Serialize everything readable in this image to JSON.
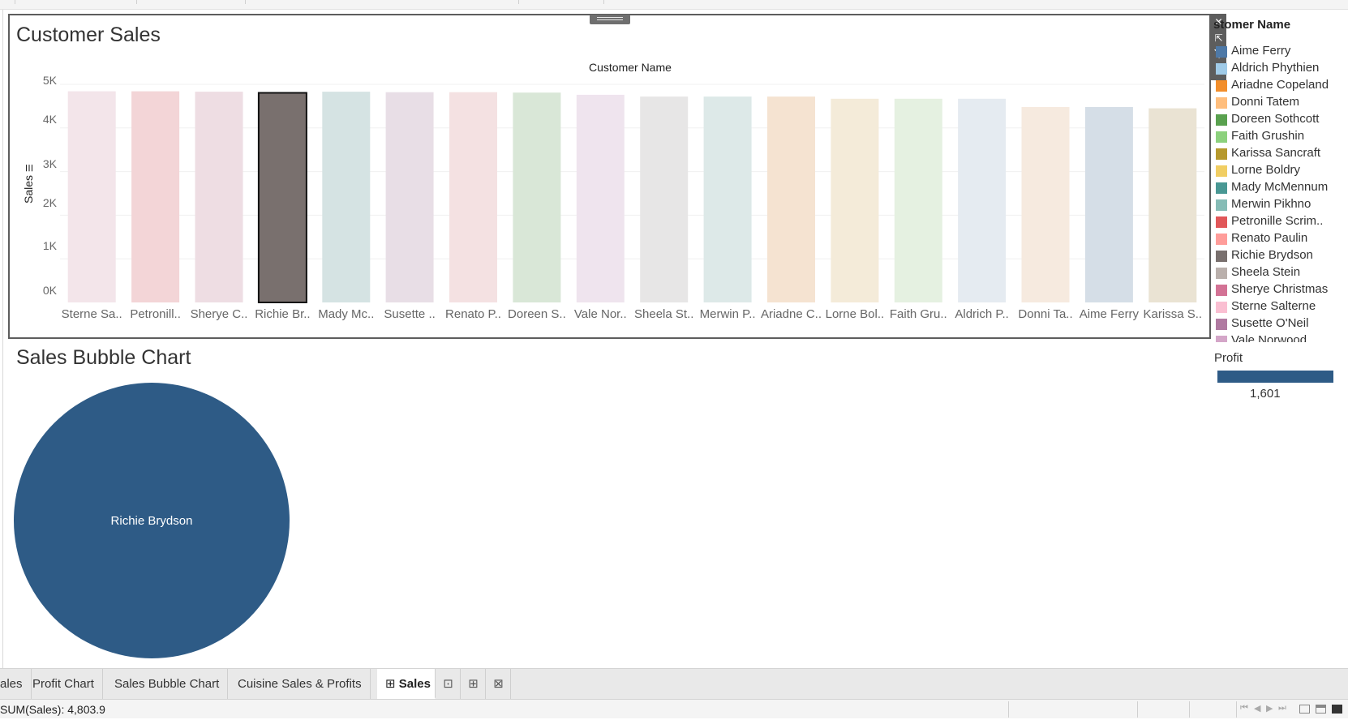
{
  "dashboard": {
    "sales_sheet": {
      "title": "Customer Sales",
      "column_header": "Customer Name",
      "y_axis_label": "Sales",
      "toolbar": {
        "close_icon": "close-icon",
        "open_icon": "open-external-icon",
        "filter_icon": "filter-icon",
        "menu_icon": "dropdown-arrow-icon"
      }
    },
    "bubble_sheet": {
      "title": "Sales Bubble Chart",
      "bubble_label": "Richie Brydson",
      "bubble_color": "#2e5b86"
    },
    "legend": {
      "title": "Customer Name",
      "visible_title": "stomer Name",
      "items": [
        {
          "label": "Aime Ferry",
          "color": "#4e79a7"
        },
        {
          "label": "Aldrich Phythien",
          "color": "#a0cbe8"
        },
        {
          "label": "Ariadne Copeland",
          "color": "#f28e2b"
        },
        {
          "label": "Donni Tatem",
          "color": "#ffbe7d"
        },
        {
          "label": "Doreen Sothcott",
          "color": "#59a14f"
        },
        {
          "label": "Faith Grushin",
          "color": "#8cd17d"
        },
        {
          "label": "Karissa Sancraft",
          "color": "#b6992d"
        },
        {
          "label": "Lorne Boldry",
          "color": "#f1ce63"
        },
        {
          "label": "Mady McMennum",
          "color": "#499894"
        },
        {
          "label": "Merwin Pikhno",
          "color": "#86bcb6"
        },
        {
          "label": "Petronille Scrim..",
          "color": "#e15759"
        },
        {
          "label": "Renato Paulin",
          "color": "#ff9d9a"
        },
        {
          "label": "Richie Brydson",
          "color": "#79706e"
        },
        {
          "label": "Sheela Stein",
          "color": "#bab0ac"
        },
        {
          "label": "Sherye Christmas",
          "color": "#d37295"
        },
        {
          "label": "Sterne Salterne",
          "color": "#fabfd2"
        },
        {
          "label": "Susette O'Neil",
          "color": "#b07aa1"
        },
        {
          "label": "Vale Norwood",
          "color": "#d4a6c8"
        }
      ]
    },
    "profit_legend": {
      "title": "Profit",
      "value": "1,601",
      "color": "#2e5b86"
    }
  },
  "chart_data": {
    "type": "bar",
    "title": "Customer Sales",
    "xlabel": "Customer Name",
    "ylabel": "Sales",
    "ylim": [
      0,
      5000
    ],
    "yticks": [
      "0K",
      "1K",
      "2K",
      "3K",
      "4K",
      "5K"
    ],
    "grid": true,
    "selected_category": "Richie Br..",
    "categories": [
      "Sterne Sa..",
      "Petronill..",
      "Sherye C..",
      "Richie Br..",
      "Mady Mc..",
      "Susette ..",
      "Renato P..",
      "Doreen S..",
      "Vale Nor..",
      "Sheela St..",
      "Merwin P..",
      "Ariadne C..",
      "Lorne Bol..",
      "Faith Gru..",
      "Aldrich P..",
      "Donni Ta..",
      "Aime Ferry",
      "Karissa S.."
    ],
    "values": [
      4840,
      4840,
      4830,
      4804,
      4830,
      4820,
      4820,
      4810,
      4760,
      4720,
      4720,
      4720,
      4670,
      4670,
      4670,
      4480,
      4480,
      4450
    ],
    "colors": [
      "#f3e5ea",
      "#f3d5d7",
      "#eedde3",
      "#79706e",
      "#d5e3e3",
      "#e8dee6",
      "#f4e1e2",
      "#d9e7d7",
      "#efe4ee",
      "#e7e6e6",
      "#dde9e8",
      "#f5e3d1",
      "#f4ebd9",
      "#e5f1e1",
      "#e5ebf1",
      "#f6eadf",
      "#d5dee7",
      "#eae3d3"
    ]
  },
  "tabs": [
    {
      "label": "ales",
      "active": false
    },
    {
      "label": "Profit Chart",
      "active": false
    },
    {
      "label": "Sales Bubble Chart",
      "active": false
    },
    {
      "label": "Cuisine Sales & Profits",
      "active": false
    },
    {
      "label": "Sales",
      "active": true,
      "icon": "dashboard-icon"
    }
  ],
  "tab_actions": [
    {
      "icon": "new-worksheet-icon"
    },
    {
      "icon": "new-dashboard-icon"
    },
    {
      "icon": "new-story-icon"
    }
  ],
  "status": {
    "summary": "SUM(Sales): 4,803.9"
  }
}
